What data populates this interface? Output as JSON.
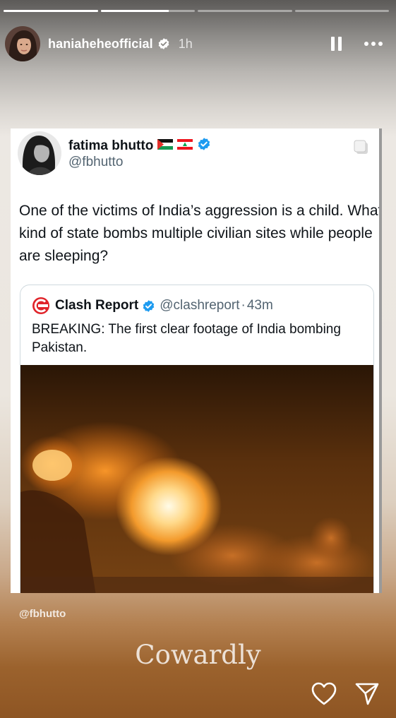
{
  "story": {
    "progress": [
      1.0,
      0.72,
      0.0,
      0.0
    ],
    "username": "haniaheheofficial",
    "time_ago": "1h",
    "icons": {
      "avatar": "avatar",
      "verified": "verified-badge-icon",
      "pause": "pause-icon",
      "more": "more-icon"
    }
  },
  "tweet": {
    "display_name": "fatima bhutto",
    "flags": [
      "palestine-flag-icon",
      "lebanon-flag-icon"
    ],
    "handle": "@fbhutto",
    "text": "One of the victims of India’s aggression is a child. What kind of state bombs multiple civilian sites while people are sleeping?",
    "quoted": {
      "display_name": "Clash Report",
      "handle": "@clashreport",
      "separator": "·",
      "time": "43m",
      "text": "BREAKING: The first clear footage of India bombing Pakistan.",
      "media": "explosion-footage-image"
    }
  },
  "mention": "@fbhutto",
  "caption": "Cowardly",
  "actions": {
    "like": "heart-icon",
    "share": "send-icon"
  },
  "colors": {
    "verified_blue": "#1d9bf0",
    "clash_red": "#e0242a"
  }
}
